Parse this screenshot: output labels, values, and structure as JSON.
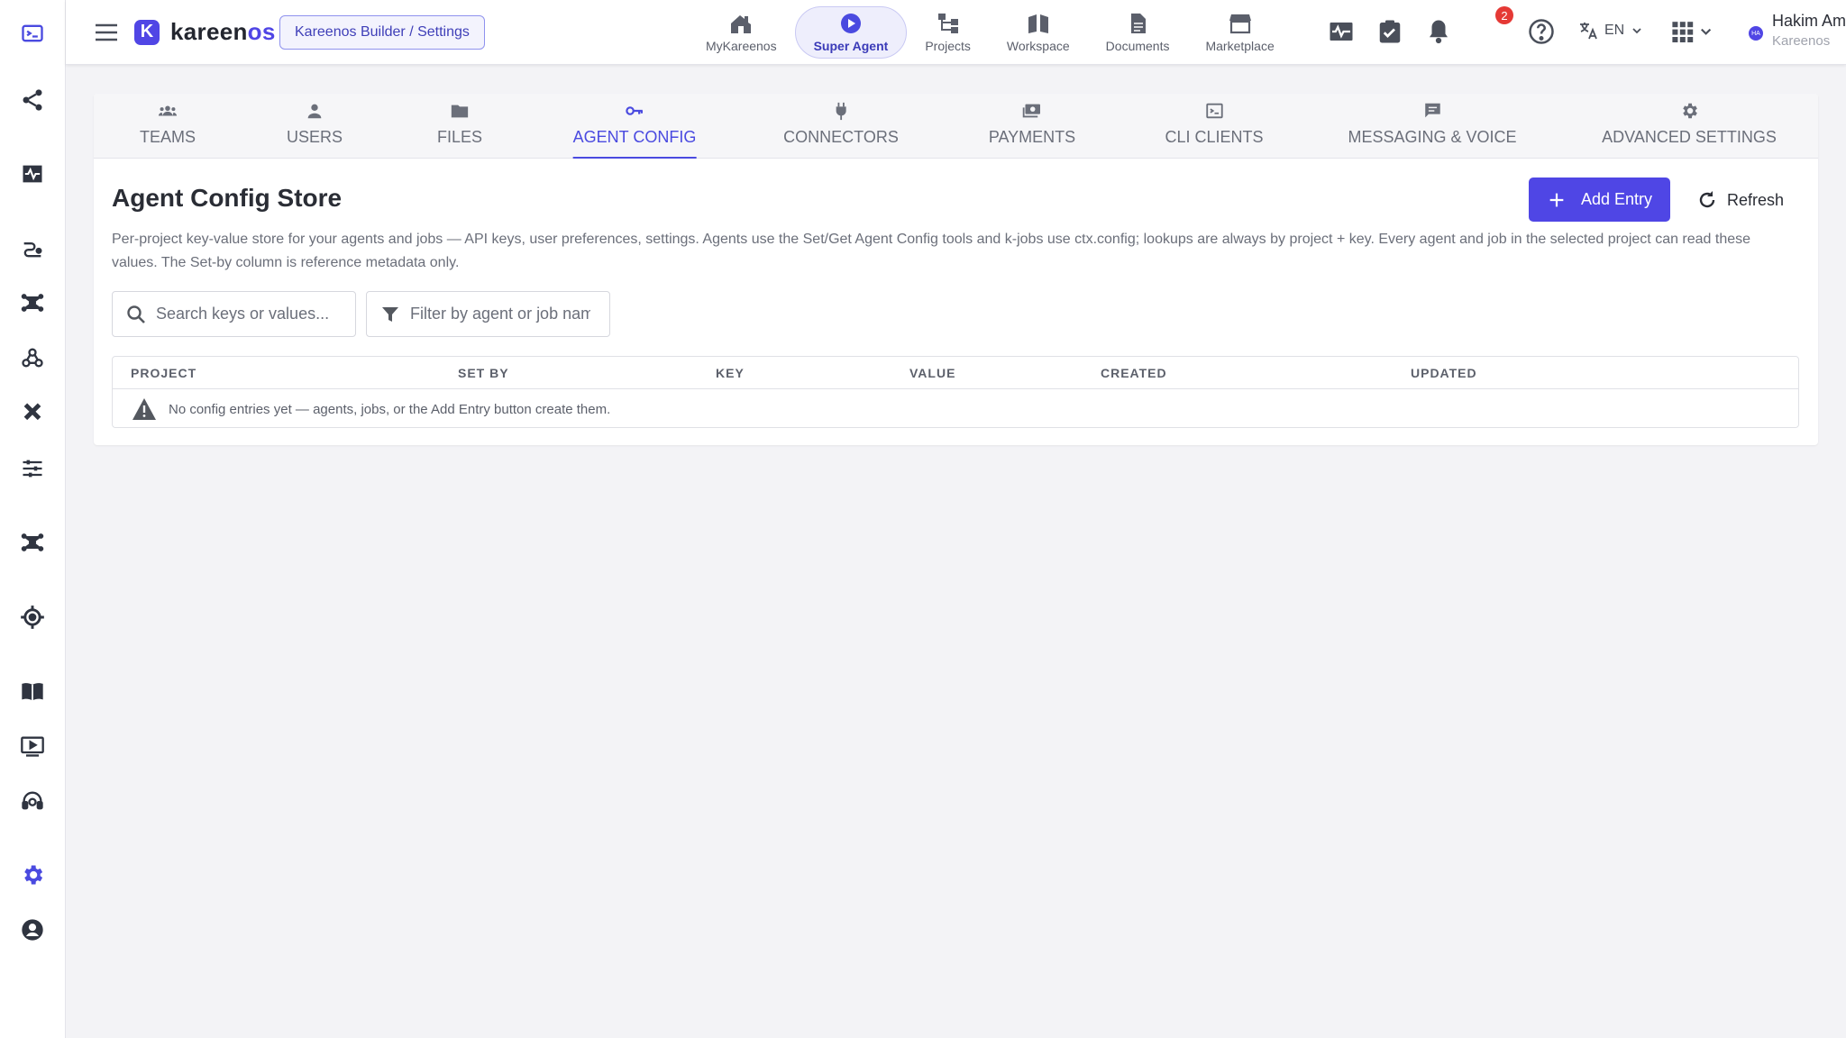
{
  "app": {
    "name_main": "kareen",
    "name_accent": "os",
    "logo_letter": "K",
    "breadcrumb": "Kareenos Builder / Settings"
  },
  "rail": {
    "items": [
      {
        "icon": "terminal-window-icon"
      },
      {
        "icon": "share-icon"
      },
      {
        "icon": "activity-monitor-icon"
      },
      {
        "icon": "workflow-icon"
      },
      {
        "icon": "hub-network-icon"
      },
      {
        "icon": "webhook-icon"
      },
      {
        "icon": "tools-icon"
      },
      {
        "icon": "sliders-icon"
      },
      {
        "icon": "hub-network-icon"
      },
      {
        "icon": "target-icon"
      },
      {
        "icon": "book-icon"
      },
      {
        "icon": "video-player-icon"
      },
      {
        "icon": "support-agent-icon"
      },
      {
        "icon": "settings-gear-icon"
      },
      {
        "icon": "account-icon"
      }
    ]
  },
  "appnav": {
    "items": [
      {
        "label": "MyKareenos",
        "icon": "home-icon"
      },
      {
        "label": "Super Agent",
        "icon": "play-circle-icon",
        "active": true
      },
      {
        "label": "Projects",
        "icon": "hierarchy-icon"
      },
      {
        "label": "Workspace",
        "icon": "open-book-icon"
      },
      {
        "label": "Documents",
        "icon": "document-icon"
      },
      {
        "label": "Marketplace",
        "icon": "storefront-icon"
      }
    ]
  },
  "topright": {
    "notifications_count": "2",
    "language": "EN",
    "user_name": "Hakim Amir",
    "user_org": "Kareenos",
    "avatar_initials": "HA"
  },
  "tabs": [
    {
      "label": "TEAMS",
      "icon": "teams-icon"
    },
    {
      "label": "USERS",
      "icon": "user-icon"
    },
    {
      "label": "FILES",
      "icon": "folder-icon"
    },
    {
      "label": "AGENT CONFIG",
      "icon": "key-icon",
      "active": true
    },
    {
      "label": "CONNECTORS",
      "icon": "plug-icon"
    },
    {
      "label": "PAYMENTS",
      "icon": "payments-icon"
    },
    {
      "label": "CLI CLIENTS",
      "icon": "terminal-icon"
    },
    {
      "label": "MESSAGING & VOICE",
      "icon": "chat-icon"
    },
    {
      "label": "ADVANCED SETTINGS",
      "icon": "gear-icon"
    }
  ],
  "page": {
    "title": "Agent Config Store",
    "add_label": "Add Entry",
    "refresh_label": "Refresh",
    "description": "Per-project key-value store for your agents and jobs — API keys, user preferences, settings. Agents use the Set/Get Agent Config tools and k-jobs use ctx.config; lookups are always by project + key. Every agent and job in the selected project can read these values. The Set-by column is reference metadata only.",
    "search_placeholder": "Search keys or values...",
    "filter_placeholder": "Filter by agent or job name"
  },
  "table": {
    "columns": [
      "PROJECT",
      "SET BY",
      "KEY",
      "VALUE",
      "CREATED",
      "UPDATED"
    ],
    "rows": [],
    "empty_message": "No config entries yet — agents, jobs, or the Add Entry button create them."
  },
  "colors": {
    "accent": "#4F46E5",
    "badge": "#E53935",
    "background": "#F3F3F6"
  }
}
